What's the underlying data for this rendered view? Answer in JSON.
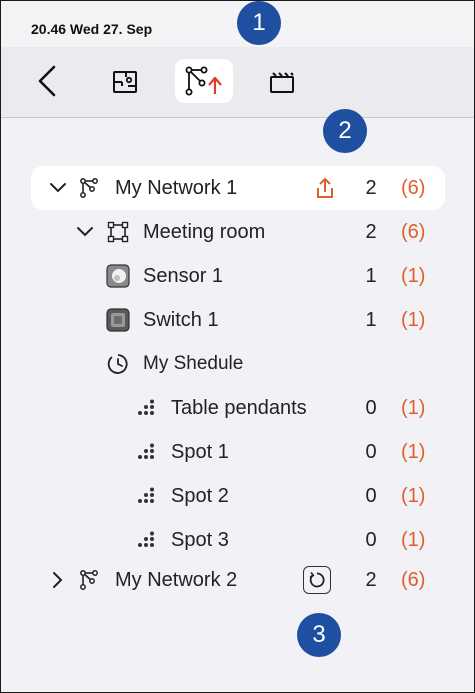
{
  "status_bar": {
    "time_date": "20.46  Wed 27. Sep"
  },
  "toolbar": {
    "items": [
      {
        "icon": "back-chevron-icon"
      },
      {
        "icon": "floor-plan-icon"
      },
      {
        "icon": "network-upload-icon",
        "selected": true
      },
      {
        "icon": "scene-icon"
      }
    ]
  },
  "callouts": [
    "1",
    "2",
    "3"
  ],
  "tree": [
    {
      "label": "My Network 1",
      "type": "network",
      "expanded": true,
      "selected": true,
      "count": "2",
      "total": "(6)",
      "action_icon": "upload-icon"
    },
    {
      "label": "Meeting room",
      "type": "room",
      "expanded": true,
      "count": "2",
      "total": "(6)"
    },
    {
      "label": "Sensor 1",
      "type": "sensor",
      "count": "1",
      "total": "(1)"
    },
    {
      "label": "Switch 1",
      "type": "switch",
      "count": "1",
      "total": "(1)"
    },
    {
      "label": "My Shedule",
      "type": "schedule"
    },
    {
      "label": "Table pendants",
      "type": "luminaire-group",
      "count": "0",
      "total": "(1)"
    },
    {
      "label": "Spot 1",
      "type": "luminaire-group",
      "count": "0",
      "total": "(1)"
    },
    {
      "label": "Spot 2",
      "type": "luminaire-group",
      "count": "0",
      "total": "(1)"
    },
    {
      "label": "Spot 3",
      "type": "luminaire-group",
      "count": "0",
      "total": "(1)"
    },
    {
      "label": "My Network 2",
      "type": "network",
      "expanded": false,
      "count": "2",
      "total": "(6)",
      "action_icon": "reset-icon"
    }
  ],
  "colors": {
    "accent_orange": "#e0602a",
    "callout_blue": "#1f4fa0",
    "upload_red": "#e23a2a"
  }
}
